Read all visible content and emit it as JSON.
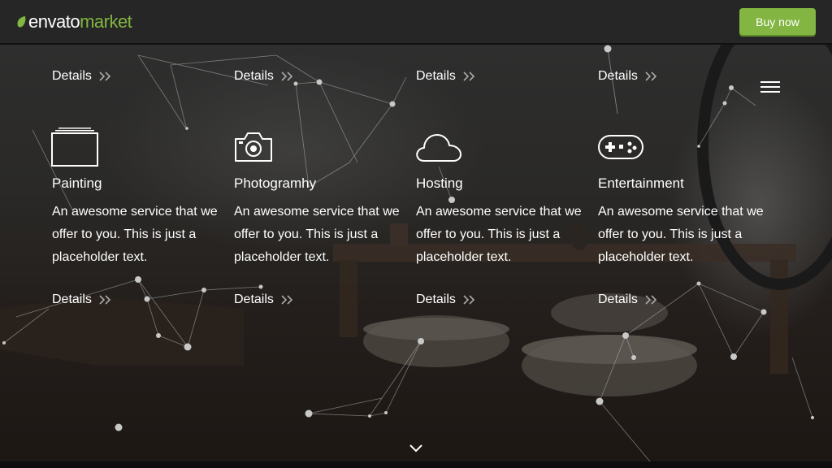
{
  "header": {
    "logo_brand": "envato",
    "logo_market": "market",
    "buy_label": "Buy now"
  },
  "top_links": [
    "Details",
    "Details",
    "Details",
    "Details"
  ],
  "services": [
    {
      "title": "Painting",
      "icon": "painting-icon",
      "description": "An awesome service that we offer to you. This is just a placeholder text.",
      "details": "Details"
    },
    {
      "title": "Photogramhy",
      "icon": "camera-icon",
      "description": "An awesome service that we offer to you. This is just a placeholder text.",
      "details": "Details"
    },
    {
      "title": "Hosting",
      "icon": "cloud-icon",
      "description": "An awesome service that we offer to you. This is just a placeholder text.",
      "details": "Details"
    },
    {
      "title": "Entertainment",
      "icon": "gamepad-icon",
      "description": "An awesome service that we offer to you. This is just a placeholder text.",
      "details": "Details"
    }
  ],
  "colors": {
    "accent": "#82b541",
    "topbar": "#262626"
  }
}
